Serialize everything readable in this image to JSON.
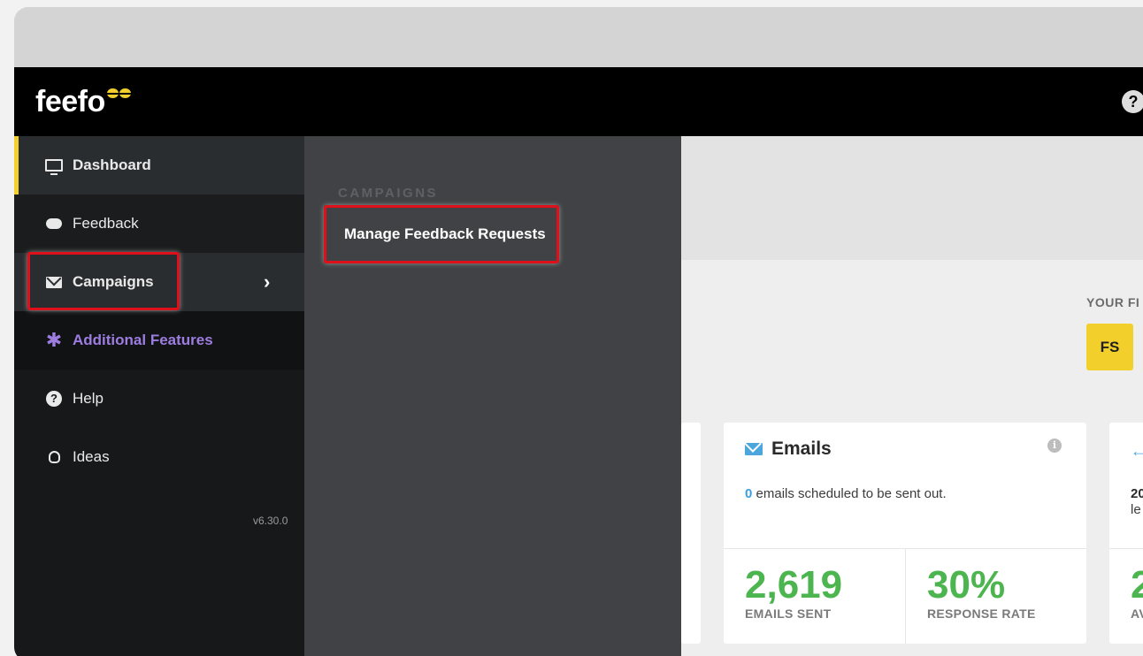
{
  "brand": {
    "logo_text": "feefo",
    "accent_color": "#f2cf2a"
  },
  "topbar": {
    "help_icon": "?"
  },
  "sidebar": {
    "items": [
      {
        "label": "Dashboard",
        "icon": "monitor-icon"
      },
      {
        "label": "Feedback",
        "icon": "chat-icon"
      },
      {
        "label": "Campaigns",
        "icon": "envelope-icon",
        "chevron": "›"
      },
      {
        "label": "Additional Features",
        "icon": "asterisk-icon",
        "color": "#9d7de0"
      },
      {
        "label": "Help",
        "icon": "question-circle-icon"
      },
      {
        "label": "Ideas",
        "icon": "lightbulb-icon"
      }
    ],
    "version": "v6.30.0"
  },
  "submenu": {
    "header": "CAMPAIGNS",
    "items": [
      {
        "label": "Manage Feedback Requests"
      }
    ]
  },
  "main": {
    "your_label": "YOUR FI",
    "badge": "FS",
    "emails_card": {
      "title": "Emails",
      "info": "i",
      "scheduled_count": "0",
      "scheduled_text": " emails scheduled to be sent out.",
      "stats": [
        {
          "value": "2,619",
          "label": "EMAILS SENT",
          "color": "#4cb54f"
        },
        {
          "value": "30%",
          "label": "RESPONSE RATE",
          "color": "#4cb54f"
        }
      ]
    },
    "right_card": {
      "text_line1": "20",
      "text_line2": "le",
      "stat_value": "2",
      "stat_label": "AV"
    }
  }
}
